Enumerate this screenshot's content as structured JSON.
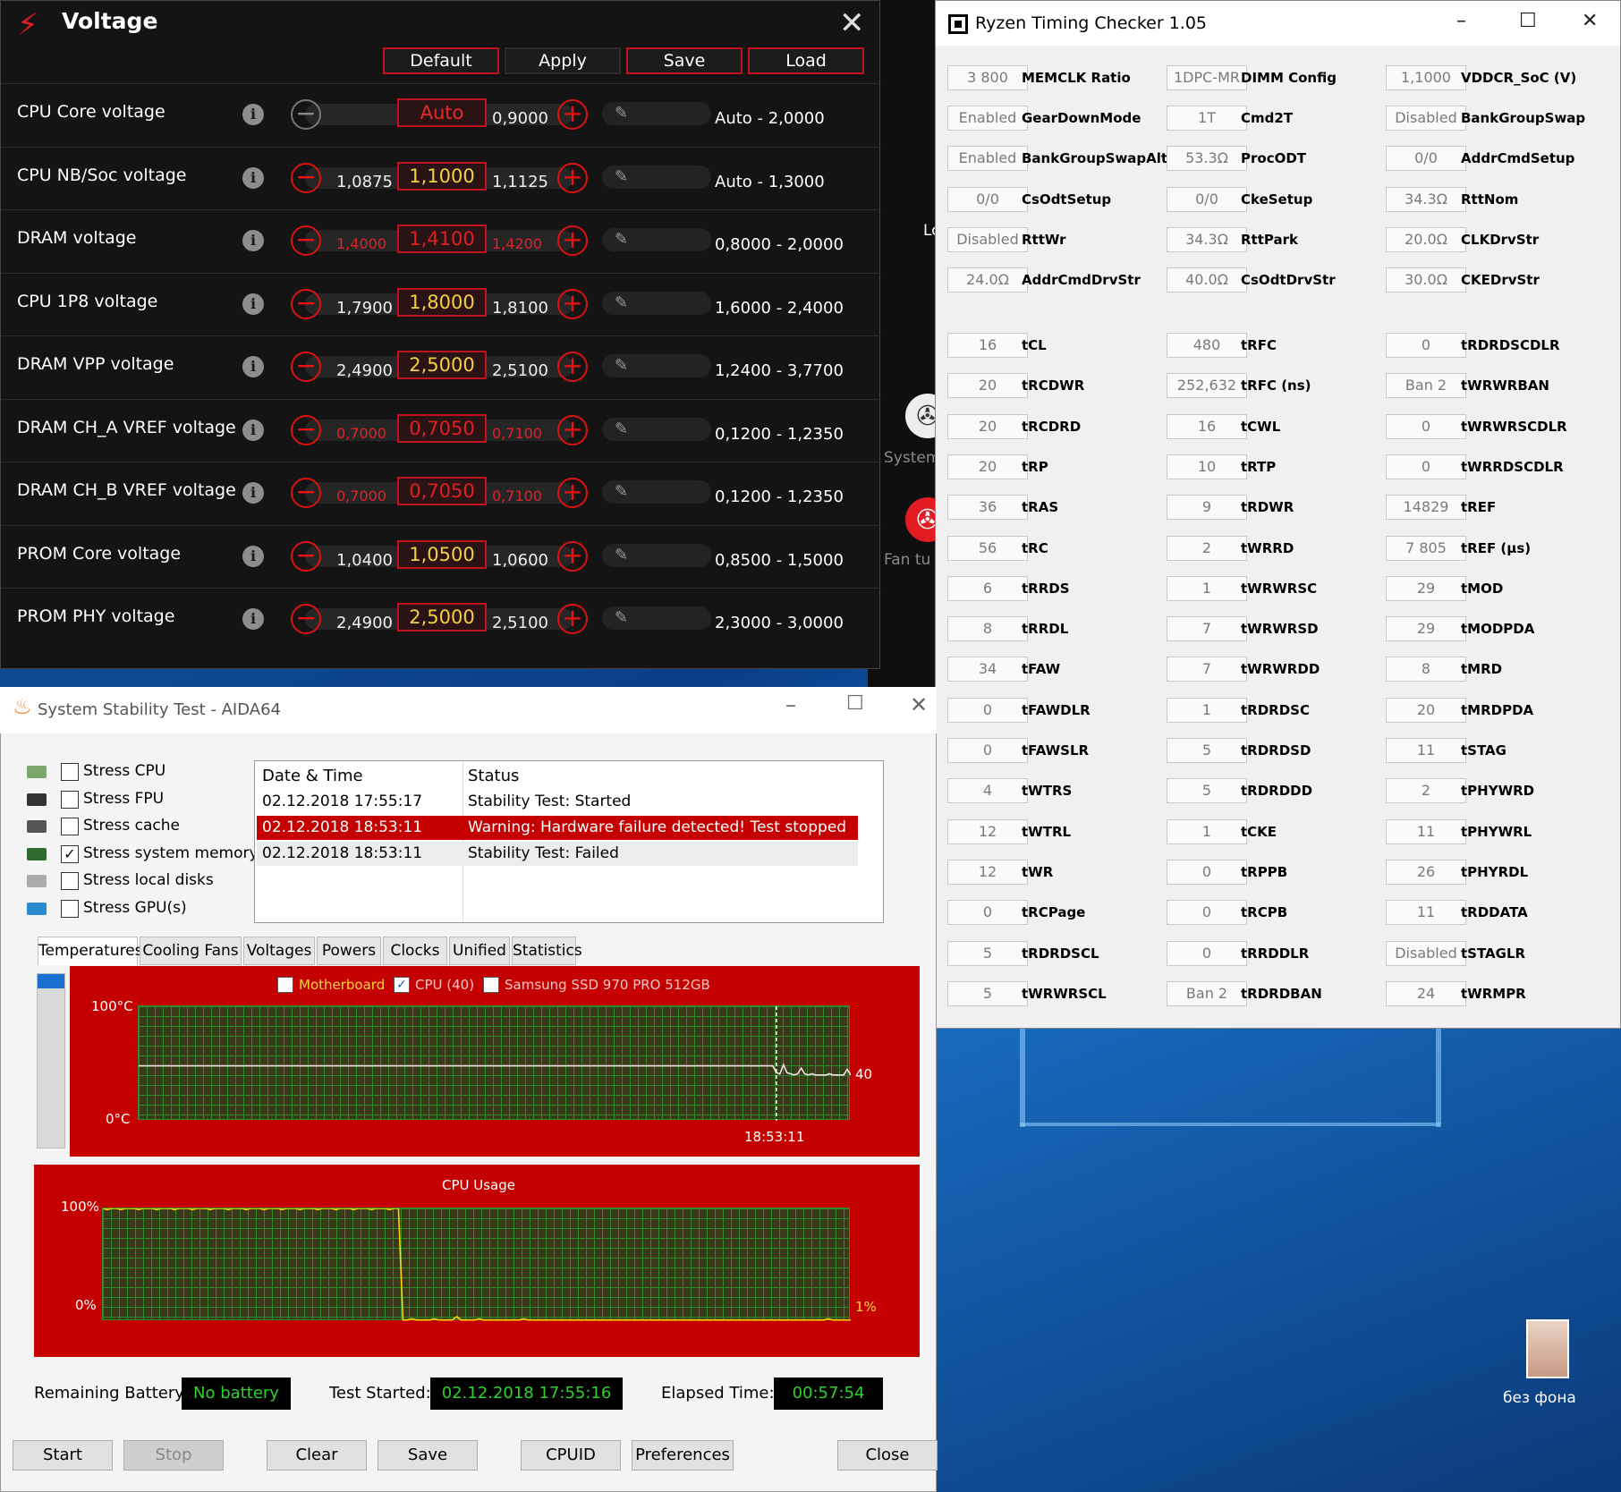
{
  "voltage": {
    "title": "Voltage",
    "buttons": {
      "default": "Default",
      "apply": "Apply",
      "save": "Save",
      "load": "Load"
    },
    "rows": [
      {
        "label": "CPU Core voltage",
        "lo": "",
        "current": "Auto",
        "hi": "0,9000",
        "range": "Auto - 2,0000"
      },
      {
        "label": "CPU NB/Soc voltage",
        "lo": "1,0875",
        "current": "1,1000",
        "hi": "1,1125",
        "range": "Auto - 1,3000"
      },
      {
        "label": "DRAM voltage",
        "lo": "1,4000",
        "current": "1,4100",
        "hi": "1,4200",
        "range": "0,8000 - 2,0000"
      },
      {
        "label": "CPU 1P8 voltage",
        "lo": "1,7900",
        "current": "1,8000",
        "hi": "1,8100",
        "range": "1,6000 - 2,4000"
      },
      {
        "label": "DRAM VPP voltage",
        "lo": "2,4900",
        "current": "2,5000",
        "hi": "2,5100",
        "range": "1,2400 - 3,7700"
      },
      {
        "label": "DRAM CH_A VREF voltage",
        "lo": "0,7000",
        "current": "0,7050",
        "hi": "0,7100",
        "range": "0,1200 - 1,2350"
      },
      {
        "label": "DRAM CH_B VREF voltage",
        "lo": "0,7000",
        "current": "0,7050",
        "hi": "0,7100",
        "range": "0,1200 - 1,2350"
      },
      {
        "label": "PROM Core voltage",
        "lo": "1,0400",
        "current": "1,0500",
        "hi": "1,0600",
        "range": "0,8500 - 1,5000"
      },
      {
        "label": "PROM PHY voltage",
        "lo": "2,4900",
        "current": "2,5000",
        "hi": "2,5100",
        "range": "2,3000 - 3,0000"
      }
    ]
  },
  "background_app": {
    "system_label": "System",
    "fan_label": "Fan tu",
    "lo_label": "Lo"
  },
  "rtc": {
    "title": "Ryzen Timing Checker 1.05",
    "col1": [
      {
        "value": "3 800",
        "label": "MEMCLK Ratio"
      },
      {
        "value": "Enabled",
        "label": "GearDownMode"
      },
      {
        "value": "Enabled",
        "label": "BankGroupSwapAlt"
      },
      {
        "value": "0/0",
        "label": "CsOdtSetup"
      },
      {
        "value": "Disabled",
        "label": "RttWr"
      },
      {
        "value": "24.0Ω",
        "label": "AddrCmdDrvStr"
      },
      {
        "value": "16",
        "label": "tCL"
      },
      {
        "value": "20",
        "label": "tRCDWR"
      },
      {
        "value": "20",
        "label": "tRCDRD"
      },
      {
        "value": "20",
        "label": "tRP"
      },
      {
        "value": "36",
        "label": "tRAS"
      },
      {
        "value": "56",
        "label": "tRC"
      },
      {
        "value": "6",
        "label": "tRRDS"
      },
      {
        "value": "8",
        "label": "tRRDL"
      },
      {
        "value": "34",
        "label": "tFAW"
      },
      {
        "value": "0",
        "label": "tFAWDLR"
      },
      {
        "value": "0",
        "label": "tFAWSLR"
      },
      {
        "value": "4",
        "label": "tWTRS"
      },
      {
        "value": "12",
        "label": "tWTRL"
      },
      {
        "value": "12",
        "label": "tWR"
      },
      {
        "value": "0",
        "label": "tRCPage"
      },
      {
        "value": "5",
        "label": "tRDRDSCL"
      },
      {
        "value": "5",
        "label": "tWRWRSCL"
      }
    ],
    "col2": [
      {
        "value": "1DPC-MR",
        "label": "DIMM Config"
      },
      {
        "value": "1T",
        "label": "Cmd2T"
      },
      {
        "value": "53.3Ω",
        "label": "ProcODT"
      },
      {
        "value": "0/0",
        "label": "CkeSetup"
      },
      {
        "value": "34.3Ω",
        "label": "RttPark"
      },
      {
        "value": "40.0Ω",
        "label": "CsOdtDrvStr"
      },
      {
        "value": "480",
        "label": "tRFC"
      },
      {
        "value": "252,632",
        "label": "tRFC (ns)"
      },
      {
        "value": "16",
        "label": "tCWL"
      },
      {
        "value": "10",
        "label": "tRTP"
      },
      {
        "value": "9",
        "label": "tRDWR"
      },
      {
        "value": "2",
        "label": "tWRRD"
      },
      {
        "value": "1",
        "label": "tWRWRSC"
      },
      {
        "value": "7",
        "label": "tWRWRSD"
      },
      {
        "value": "7",
        "label": "tWRWRDD"
      },
      {
        "value": "1",
        "label": "tRDRDSC"
      },
      {
        "value": "5",
        "label": "tRDRDSD"
      },
      {
        "value": "5",
        "label": "tRDRDDD"
      },
      {
        "value": "1",
        "label": "tCKE"
      },
      {
        "value": "0",
        "label": "tRPPB"
      },
      {
        "value": "0",
        "label": "tRCPB"
      },
      {
        "value": "0",
        "label": "tRRDDLR"
      },
      {
        "value": "Ban 2",
        "label": "tRDRDBAN"
      }
    ],
    "col3": [
      {
        "value": "1,1000",
        "label": "VDDCR_SoC (V)"
      },
      {
        "value": "Disabled",
        "label": "BankGroupSwap"
      },
      {
        "value": "0/0",
        "label": "AddrCmdSetup"
      },
      {
        "value": "34.3Ω",
        "label": "RttNom"
      },
      {
        "value": "20.0Ω",
        "label": "CLKDrvStr"
      },
      {
        "value": "30.0Ω",
        "label": "CKEDrvStr"
      },
      {
        "value": "0",
        "label": "tRDRDSCDLR"
      },
      {
        "value": "Ban 2",
        "label": "tWRWRBAN"
      },
      {
        "value": "0",
        "label": "tWRWRSCDLR"
      },
      {
        "value": "0",
        "label": "tWRRDSCDLR"
      },
      {
        "value": "14829",
        "label": "tREF"
      },
      {
        "value": "7 805",
        "label": "tREF (µs)"
      },
      {
        "value": "29",
        "label": "tMOD"
      },
      {
        "value": "29",
        "label": "tMODPDA"
      },
      {
        "value": "8",
        "label": "tMRD"
      },
      {
        "value": "20",
        "label": "tMRDPDA"
      },
      {
        "value": "11",
        "label": "tSTAG"
      },
      {
        "value": "2",
        "label": "tPHYWRD"
      },
      {
        "value": "11",
        "label": "tPHYWRL"
      },
      {
        "value": "26",
        "label": "tPHYRDL"
      },
      {
        "value": "11",
        "label": "tRDDATA"
      },
      {
        "value": "Disabled",
        "label": "tSTAGLR"
      },
      {
        "value": "24",
        "label": "tWRMPR"
      }
    ]
  },
  "aida": {
    "title": "System Stability Test - AIDA64",
    "stress": [
      {
        "label": "Stress CPU",
        "checked": false
      },
      {
        "label": "Stress FPU",
        "checked": false
      },
      {
        "label": "Stress cache",
        "checked": false
      },
      {
        "label": "Stress system memory",
        "checked": true
      },
      {
        "label": "Stress local disks",
        "checked": false
      },
      {
        "label": "Stress GPU(s)",
        "checked": false
      }
    ],
    "log_headers": {
      "date": "Date & Time",
      "status": "Status"
    },
    "log": [
      {
        "date": "02.12.2018 17:55:17",
        "status": "Stability Test: Started"
      },
      {
        "date": "02.12.2018 18:53:11",
        "status": "Warning: Hardware failure detected! Test stopped"
      },
      {
        "date": "02.12.2018 18:53:11",
        "status": "Stability Test: Failed"
      }
    ],
    "tabs": [
      "Temperatures",
      "Cooling Fans",
      "Voltages",
      "Powers",
      "Clocks",
      "Unified",
      "Statistics"
    ],
    "temp_legend": {
      "motherboard": "Motherboard",
      "cpu": "CPU (40)",
      "ssd": "Samsung SSD 970 PRO 512GB"
    },
    "temp_axis": {
      "top": "100°C",
      "bottom": "0°C",
      "time": "18:53:11",
      "value": "40"
    },
    "usage_title": "CPU Usage",
    "usage_axis": {
      "top": "100%",
      "bottom": "0%",
      "value": "1%"
    },
    "battery_label": "Remaining Battery:",
    "battery_value": "No battery",
    "started_label": "Test Started:",
    "started_value": "02.12.2018 17:55:16",
    "elapsed_label": "Elapsed Time:",
    "elapsed_value": "00:57:54",
    "buttons": {
      "start": "Start",
      "stop": "Stop",
      "clear": "Clear",
      "save": "Save",
      "cpuid": "CPUID",
      "preferences": "Preferences",
      "close": "Close"
    }
  },
  "desktop": {
    "icon_label": "без фона"
  },
  "chart_data": [
    {
      "type": "line",
      "title": "",
      "ylabel": "",
      "ylim": [
        0,
        100
      ],
      "series": [
        {
          "name": "CPU (40)",
          "values": [
            48,
            48,
            48,
            48,
            48,
            48,
            48,
            48,
            48,
            48,
            48,
            48,
            48,
            48,
            48,
            48,
            48,
            48,
            48,
            48,
            48,
            48,
            48,
            48,
            48,
            48,
            48,
            48,
            48,
            48,
            48,
            48,
            48,
            48,
            48,
            48,
            48,
            48,
            48,
            48,
            48,
            48,
            48,
            48,
            48,
            48,
            48,
            48,
            48,
            48,
            48,
            48,
            48,
            48,
            48,
            48,
            48,
            48,
            48,
            48,
            48,
            48,
            48,
            48,
            48,
            48,
            48,
            48,
            48,
            48,
            48,
            48,
            48,
            48,
            48,
            48,
            48,
            48,
            48,
            48,
            48,
            48,
            48,
            48,
            48,
            48,
            48,
            48,
            48,
            48,
            48,
            48,
            48,
            48,
            48,
            48,
            48,
            48,
            48,
            48,
            48,
            48,
            48,
            48,
            48,
            48,
            48,
            48,
            48,
            48,
            48,
            48,
            48,
            48,
            48,
            48,
            48,
            48,
            48,
            48,
            48,
            48,
            48,
            48,
            48,
            48,
            48,
            48,
            48,
            48,
            48,
            48,
            48,
            48,
            48,
            48,
            48,
            48,
            48,
            48,
            48,
            48,
            48,
            48,
            48,
            48,
            48,
            48,
            48,
            48,
            48,
            48,
            48,
            48,
            48,
            48,
            48,
            48,
            48,
            48,
            48,
            48,
            48,
            48,
            48,
            48,
            48,
            48,
            48,
            48,
            48,
            48,
            48,
            48,
            48,
            48,
            48,
            48,
            48,
            48,
            42,
            41,
            49,
            42,
            41,
            40,
            41,
            46,
            41,
            40,
            41,
            40,
            40,
            40,
            40,
            41,
            40,
            40,
            40,
            40,
            45,
            40
          ]
        }
      ],
      "annotation": "18:53:11"
    },
    {
      "type": "line",
      "title": "CPU Usage",
      "ylim": [
        0,
        100
      ],
      "series": [
        {
          "name": "",
          "values": [
            100,
            99,
            100,
            100,
            99,
            100,
            100,
            100,
            99,
            100,
            100,
            100,
            99,
            100,
            100,
            100,
            99,
            100,
            100,
            100,
            99,
            100,
            100,
            100,
            99,
            100,
            100,
            100,
            99,
            100,
            100,
            100,
            99,
            100,
            100,
            100,
            99,
            100,
            100,
            100,
            99,
            100,
            100,
            100,
            99,
            100,
            100,
            100,
            99,
            100,
            100,
            100,
            99,
            100,
            100,
            100,
            99,
            100,
            100,
            100,
            99,
            100,
            100,
            100,
            99,
            100,
            100,
            1,
            1,
            2,
            1,
            1,
            1,
            1,
            2,
            1,
            1,
            1,
            1,
            4,
            1,
            1,
            1,
            1,
            2,
            1,
            1,
            1,
            1,
            1,
            1,
            1,
            1,
            1,
            2,
            1,
            1,
            1,
            1,
            1,
            1,
            1,
            1,
            1,
            1,
            1,
            1,
            1,
            1,
            1,
            1,
            1,
            1,
            1,
            1,
            1,
            1,
            1,
            1,
            1,
            1,
            1,
            1,
            1,
            1,
            1,
            1,
            1,
            1,
            1,
            1,
            1,
            1,
            1,
            1,
            1,
            1,
            1,
            1,
            1,
            1,
            1,
            1,
            1,
            1,
            1,
            1,
            1,
            1,
            1,
            1,
            1,
            1,
            1,
            1,
            1,
            1,
            1,
            1,
            1,
            1,
            1,
            2,
            1,
            1,
            1,
            1,
            1
          ]
        }
      ]
    }
  ]
}
